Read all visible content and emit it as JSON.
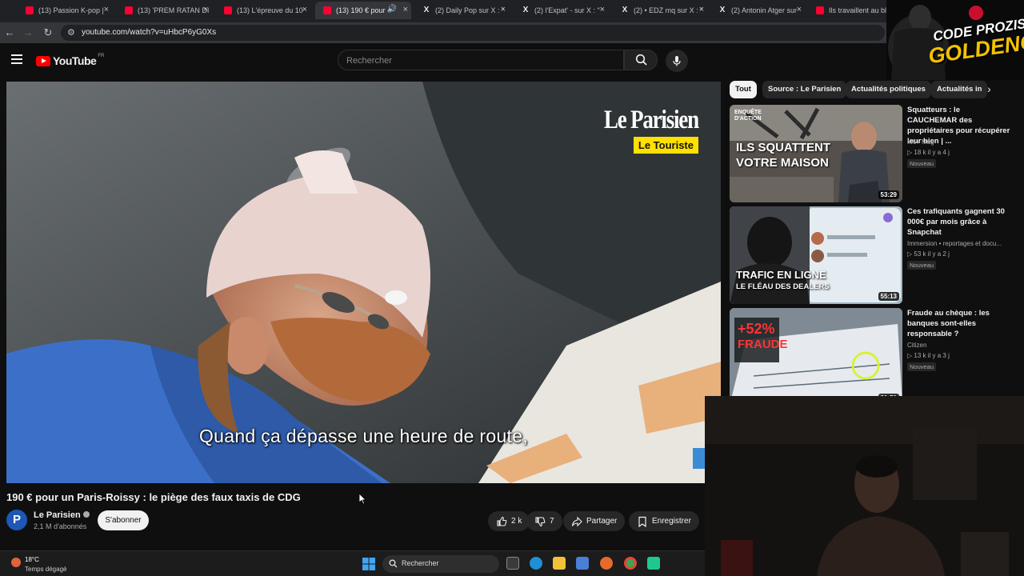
{
  "browser": {
    "tabs": [
      {
        "label": "(13) Passion K-pop | ",
        "icon": "youtube-icon"
      },
      {
        "label": "(13) 'PREM RATAN DI",
        "icon": "youtube-icon"
      },
      {
        "label": "(13) L'épreuve du 10",
        "icon": "youtube-icon"
      },
      {
        "label": "(13) 190 € pour u",
        "icon": "youtube-icon",
        "active": true
      },
      {
        "label": "(2) Daily Pop sur X : \"",
        "icon": "x-icon"
      },
      {
        "label": "(2) l'Expat' - sur X : \"",
        "icon": "x-icon"
      },
      {
        "label": "(2) • EDZ mq sur X : \"",
        "icon": "x-icon"
      },
      {
        "label": "(2) Antonin Atger sur",
        "icon": "x-icon"
      },
      {
        "label": "Ils travaillent au blac",
        "icon": "youtube-icon"
      }
    ],
    "url": "youtube.com/watch?v=uHbcP6yG0Xs"
  },
  "youtube": {
    "logo_text": "YouTube",
    "country_code": "FR",
    "search_placeholder": "Rechercher"
  },
  "video": {
    "subtitle": "Quand ça dépasse une heure de route,",
    "brand_name": "Le Parisien",
    "brand_tag": "Le Touriste",
    "title": "190 € pour un Paris-Roissy : le piège des faux taxis de CDG",
    "channel": {
      "name": "Le Parisien",
      "avatar_letter": "P",
      "subscribers": "2,1 M d'abonnés"
    },
    "subscribe_label": "S'abonner",
    "likes": "2 k",
    "dislikes": "7",
    "share_label": "Partager",
    "save_label": "Enregistrer"
  },
  "sidebar": {
    "chips": [
      "Tout",
      "Source : Le Parisien",
      "Actualités politiques",
      "Actualités in"
    ],
    "recommendations": [
      {
        "title": "Squatteurs : le CAUCHEMAR des propriétaires pour récupérer leur bien | ...",
        "channel": "M6+ Mag",
        "stats": "▷ 18 k   il y a 4 j",
        "badge": "Nouveau",
        "duration": "53:29",
        "thumb_lines": [
          "ILS SQUATTENT",
          "VOTRE MAISON"
        ],
        "thumb_corner": "ENQUÊTE D'ACTION"
      },
      {
        "title": "Ces trafiquants gagnent 30 000€ par mois grâce à Snapchat",
        "channel": "Immersion • reportages et docu...",
        "stats": "▷ 53 k   il y a 2 j",
        "badge": "Nouveau",
        "duration": "55:13",
        "thumb_lines": [
          "TRAFIC EN LIGNE",
          "LE FLÉAU DES DEALERS"
        ]
      },
      {
        "title": "Fraude au chèque : les banques sont-elles responsable ?",
        "channel": "Citizen",
        "stats": "▷ 13 k   il y a 3 j",
        "badge": "Nouveau",
        "duration": "31:51",
        "thumb_lines": [
          "+52%",
          "FRAUDE"
        ]
      }
    ]
  },
  "overlay": {
    "line1": "CODE PROZIS",
    "line2": "GOLDENG"
  },
  "taskbar": {
    "temperature": "18°C",
    "weather": "Temps dégagé",
    "search_label": "Rechercher"
  },
  "colors": {
    "youtube_red": "#ff0000",
    "brand_yellow": "#ffe000",
    "overlay_gold": "#f2c200",
    "background": "#0f0f0f"
  }
}
